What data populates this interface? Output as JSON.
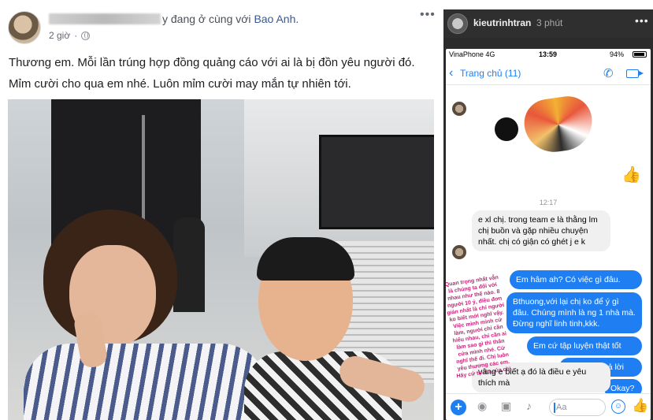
{
  "post": {
    "header_suffix": "y đang ở cùng với ",
    "tagged_name": "Bao Anh.",
    "time": "2 giờ",
    "more": "•••",
    "text_line1": "Thương em. Mỗi lần trúng hợp đồng quảng cáo với ai là bị đồn yêu người đó.",
    "text_line2": "Mỉm cười cho qua em nhé. Luôn mỉm cười may mắn tự nhiên tới."
  },
  "story": {
    "username": "kieutrinhtran",
    "time": "3 phút",
    "more": "•••",
    "status": {
      "carrier": "VinaPhone  4G",
      "clock": "13:59",
      "battery": "94%"
    },
    "nav": {
      "back": "‹",
      "title": "Trang chủ (11)",
      "phone_icon": "✆"
    },
    "timestamp": "12:17",
    "messages": [
      {
        "dir": "in",
        "text": "e xl chị. trong team e là thằng lm chị buồn và gặp nhiều chuyện nhất. chị có giận có ghét j e k"
      },
      {
        "dir": "out",
        "text": "Em hâm ah? Có việc gì đâu."
      },
      {
        "dir": "out",
        "text": "Bthuong,với lại chị ko để ý gì đâu. Chúng mình là ng 1 nhà mà. Đừng nghĩ linh tinh,kkk."
      },
      {
        "dir": "out",
        "text": "Em cứ tập luyện thật tốt"
      },
      {
        "dir": "out",
        "text": "Đó là câu trả lời"
      },
      {
        "dir": "out",
        "text": "Okay?"
      },
      {
        "dir": "in",
        "text": "vâng e biết ạ đó là điều e yêu thích mà"
      }
    ],
    "overlay_text": "Quan trọng nhất vẫn là chúng ta đối với nhau như thế nào. 8 người 10 ý, điều đơn giản nhất là chỉ người ko biết mới nghĩ vậy. Việc mình mình cứ làm, người chỉ cần hiểu nhau, chỉ cần ai làm sao gì thì thân cửa mình nhé. Cứ nghĩ thế đi. Chị luôn yêu thương các em. Hãy cứ tự do của chị.",
    "compose": {
      "plus": "+",
      "camera_icon": "◉",
      "gallery_icon": "▣",
      "mic_icon": "♪",
      "placeholder": "Aa",
      "emoji_icon": "☺",
      "like_icon": "👍"
    },
    "thumb_icon": "👍"
  }
}
